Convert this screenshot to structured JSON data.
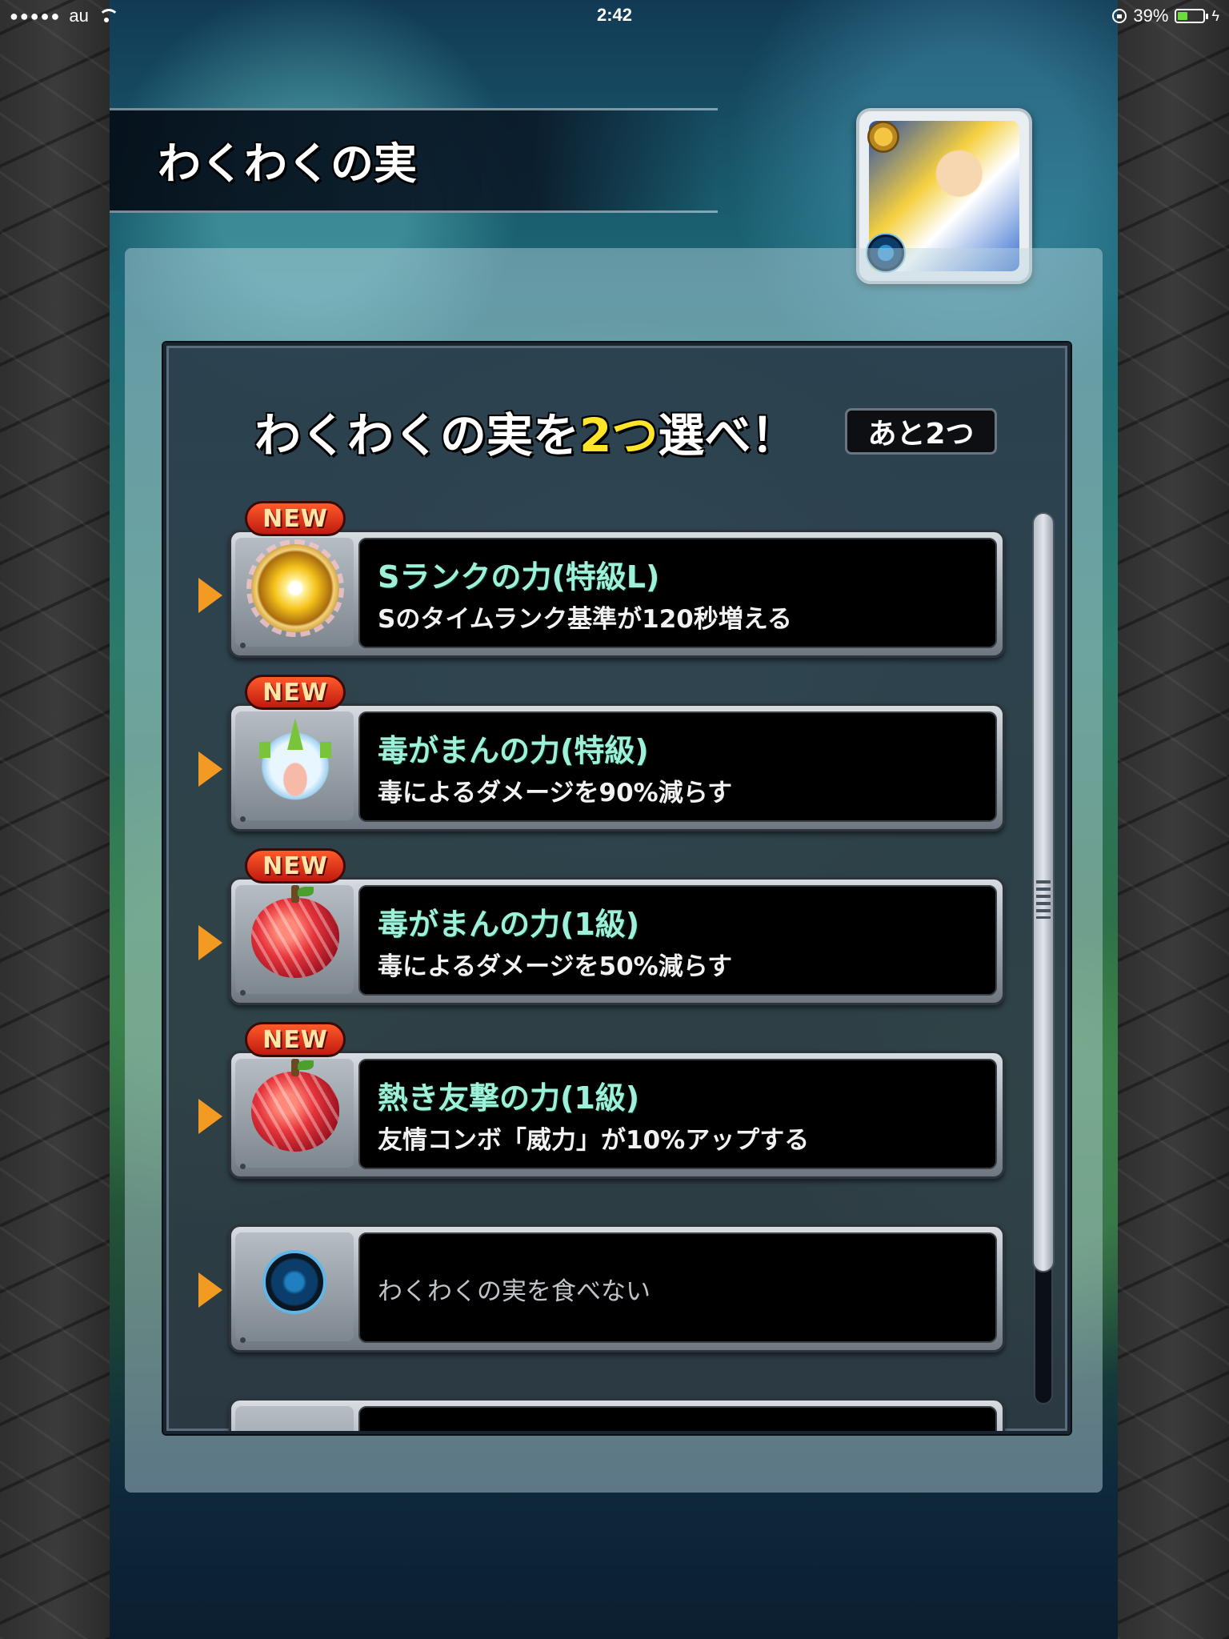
{
  "status_bar": {
    "signal": "●●●●●",
    "carrier": "au",
    "time": "2:42",
    "battery_percent": "39%",
    "battery_level": 0.39
  },
  "header": {
    "title": "わくわくの実"
  },
  "panel": {
    "prompt_before": "わくわくの実を",
    "prompt_highlight": "2つ",
    "prompt_after": "選べ！",
    "remaining": "あと2つ"
  },
  "items": [
    {
      "badge": "NEW",
      "title": "Sランクの力(特級L)",
      "description": "Sのタイムランク基準が120秒増える",
      "icon": "golden-sun-orb-icon"
    },
    {
      "badge": "NEW",
      "title": "毒がまんの力(特級)",
      "description": "毒によるダメージを90%減らす",
      "icon": "crystal-lotus-icon"
    },
    {
      "badge": "NEW",
      "title": "毒がまんの力(1級)",
      "description": "毒によるダメージを50%減らす",
      "icon": "red-fruit-icon"
    },
    {
      "badge": "NEW",
      "title": "熱き友撃の力(1級)",
      "description": "友情コンボ「威力」が10%アップする",
      "icon": "red-fruit-icon"
    },
    {
      "badge": "",
      "title": "",
      "description": "わくわくの実を食べない",
      "icon": "blue-orb-icon"
    }
  ],
  "colors": {
    "title_text": "#9ff0d8",
    "highlight": "#ffe52a",
    "arrow": "#f39a22",
    "new_badge": "#e0301c"
  }
}
